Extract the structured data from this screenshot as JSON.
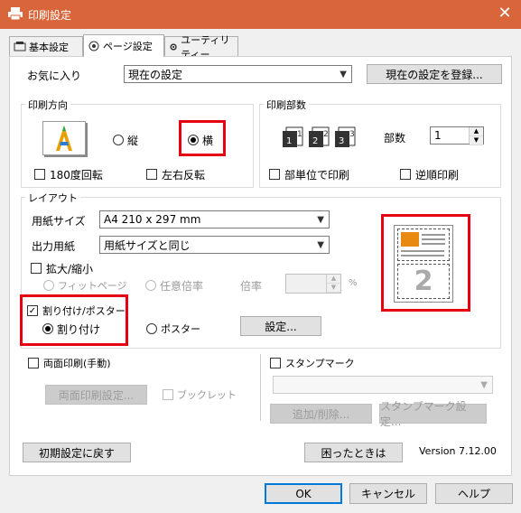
{
  "window": {
    "title": "印刷設定",
    "close_glyph": "✕"
  },
  "tabs": [
    {
      "label": "基本設定"
    },
    {
      "label": "ページ設定"
    },
    {
      "label": "ユーティリティー"
    }
  ],
  "favorites": {
    "label": "お気に入り",
    "selected": "現在の設定",
    "register_button": "現在の設定を登録..."
  },
  "orientation": {
    "group_label": "印刷方向",
    "portrait_label": "縦",
    "landscape_label": "横",
    "selected": "横",
    "rotate_180_label": "180度回転",
    "mirror_label": "左右反転"
  },
  "copies": {
    "group_label": "印刷部数",
    "count_label": "部数",
    "count_value": "1",
    "collate_label": "部単位で印刷",
    "reverse_label": "逆順印刷"
  },
  "layout": {
    "group_label": "レイアウト",
    "paper_size_label": "用紙サイズ",
    "paper_size_value": "A4 210 x 297 mm",
    "output_paper_label": "出力用紙",
    "output_paper_value": "用紙サイズと同じ",
    "scale_label": "拡大/縮小",
    "fit_page_label": "フィットページ",
    "custom_scale_label": "任意倍率",
    "ratio_label": "倍率",
    "ratio_unit": "%",
    "ratio_value": "",
    "nup_poster_label": "割り付け/ポスター",
    "nup_label": "割り付け",
    "poster_label": "ポスター",
    "settings_button": "設定...",
    "preview_number": "2"
  },
  "duplex": {
    "label": "両面印刷(手動)",
    "settings_button": "両面印刷設定...",
    "booklet_label": "ブックレット"
  },
  "stamp": {
    "label": "スタンプマーク",
    "select_value": "",
    "add_delete_button": "追加/削除...",
    "settings_button": "スタンプマーク設定..."
  },
  "footer": {
    "reset_button": "初期設定に戻す",
    "help_when_button": "困ったときは",
    "version": "Version 7.12.00"
  },
  "dialog_buttons": {
    "ok": "OK",
    "cancel": "キャンセル",
    "help": "ヘルプ"
  },
  "colors": {
    "titlebar": "#d9653b",
    "highlight": "#e60012",
    "ok_border": "#0078d7"
  }
}
